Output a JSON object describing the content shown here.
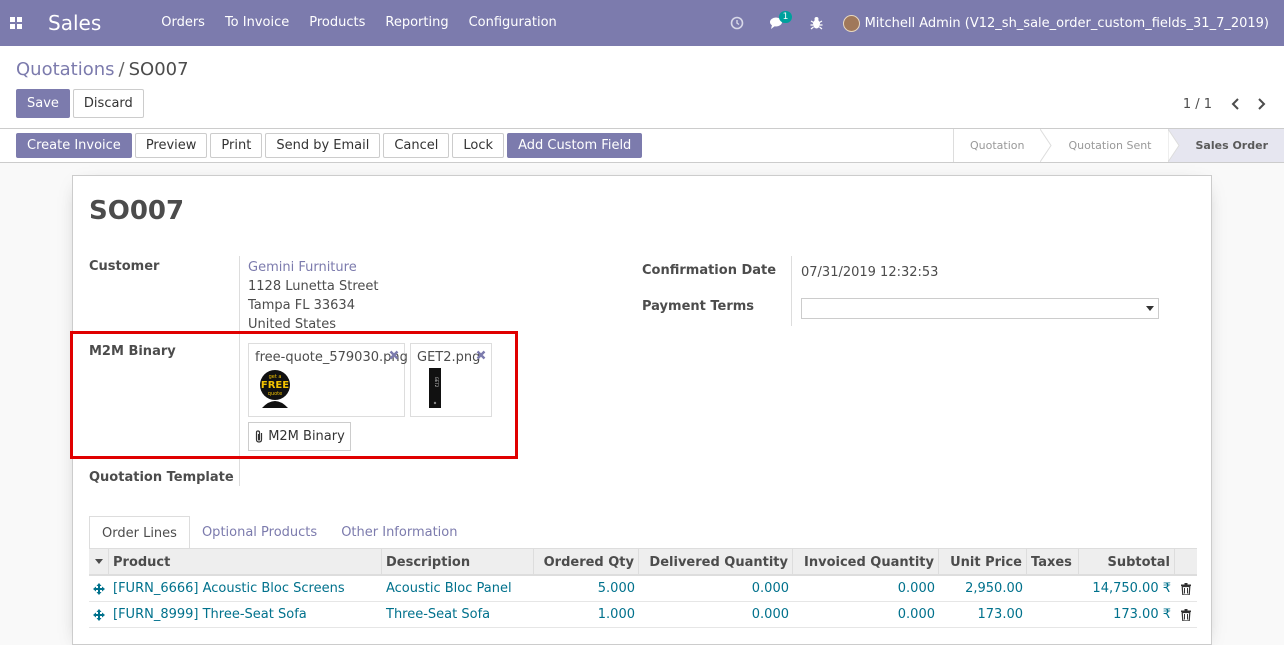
{
  "navbar": {
    "brand": "Sales",
    "menu": [
      "Orders",
      "To Invoice",
      "Products",
      "Reporting",
      "Configuration"
    ],
    "chat_count": "1",
    "user_name": "Mitchell Admin (V12_sh_sale_order_custom_fields_31_7_2019)",
    "color": "#7c7bad"
  },
  "breadcrumb": {
    "parent": "Quotations",
    "separator": "/",
    "current": "SO007"
  },
  "control": {
    "save": "Save",
    "discard": "Discard",
    "pager": "1 / 1"
  },
  "statusbar": {
    "buttons": [
      "Create Invoice",
      "Preview",
      "Print",
      "Send by Email",
      "Cancel",
      "Lock",
      "Add Custom Field"
    ],
    "steps": [
      "Quotation",
      "Quotation Sent",
      "Sales Order"
    ],
    "active_step": "Sales Order"
  },
  "form": {
    "title": "SO007",
    "customer_label": "Customer",
    "customer_name": "Gemini Furniture",
    "customer_address": [
      "1128 Lunetta Street",
      "Tampa FL 33634",
      "United States"
    ],
    "m2m_label": "M2M Binary",
    "attachments": [
      {
        "name": "free-quote_579030.png",
        "thumb": "free-quote-thumbnail"
      },
      {
        "name": "GET2.png",
        "thumb": "get2-thumbnail"
      }
    ],
    "m2m_button": "M2M Binary",
    "template_label": "Quotation Template",
    "confirmation_label": "Confirmation Date",
    "confirmation_value": "07/31/2019 12:32:53",
    "payment_terms_label": "Payment Terms",
    "thumb_text": [
      "get a",
      "FREE",
      "quote"
    ],
    "thumb2_text": "GET2"
  },
  "tabs": [
    "Order Lines",
    "Optional Products",
    "Other Information"
  ],
  "table": {
    "headers": [
      "Product",
      "Description",
      "Ordered Qty",
      "Delivered Quantity",
      "Invoiced Quantity",
      "Unit Price",
      "Taxes",
      "Subtotal"
    ],
    "rows": [
      {
        "product": "[FURN_6666] Acoustic Bloc Screens",
        "description": "Acoustic Bloc Panel",
        "ordered": "5.000",
        "delivered": "0.000",
        "invoiced": "0.000",
        "price": "2,950.00",
        "taxes": "",
        "subtotal": "14,750.00 ₹"
      },
      {
        "product": "[FURN_8999] Three-Seat Sofa",
        "description": "Three-Seat Sofa",
        "ordered": "1.000",
        "delivered": "0.000",
        "invoiced": "0.000",
        "price": "173.00",
        "taxes": "",
        "subtotal": "173.00 ₹"
      }
    ]
  }
}
